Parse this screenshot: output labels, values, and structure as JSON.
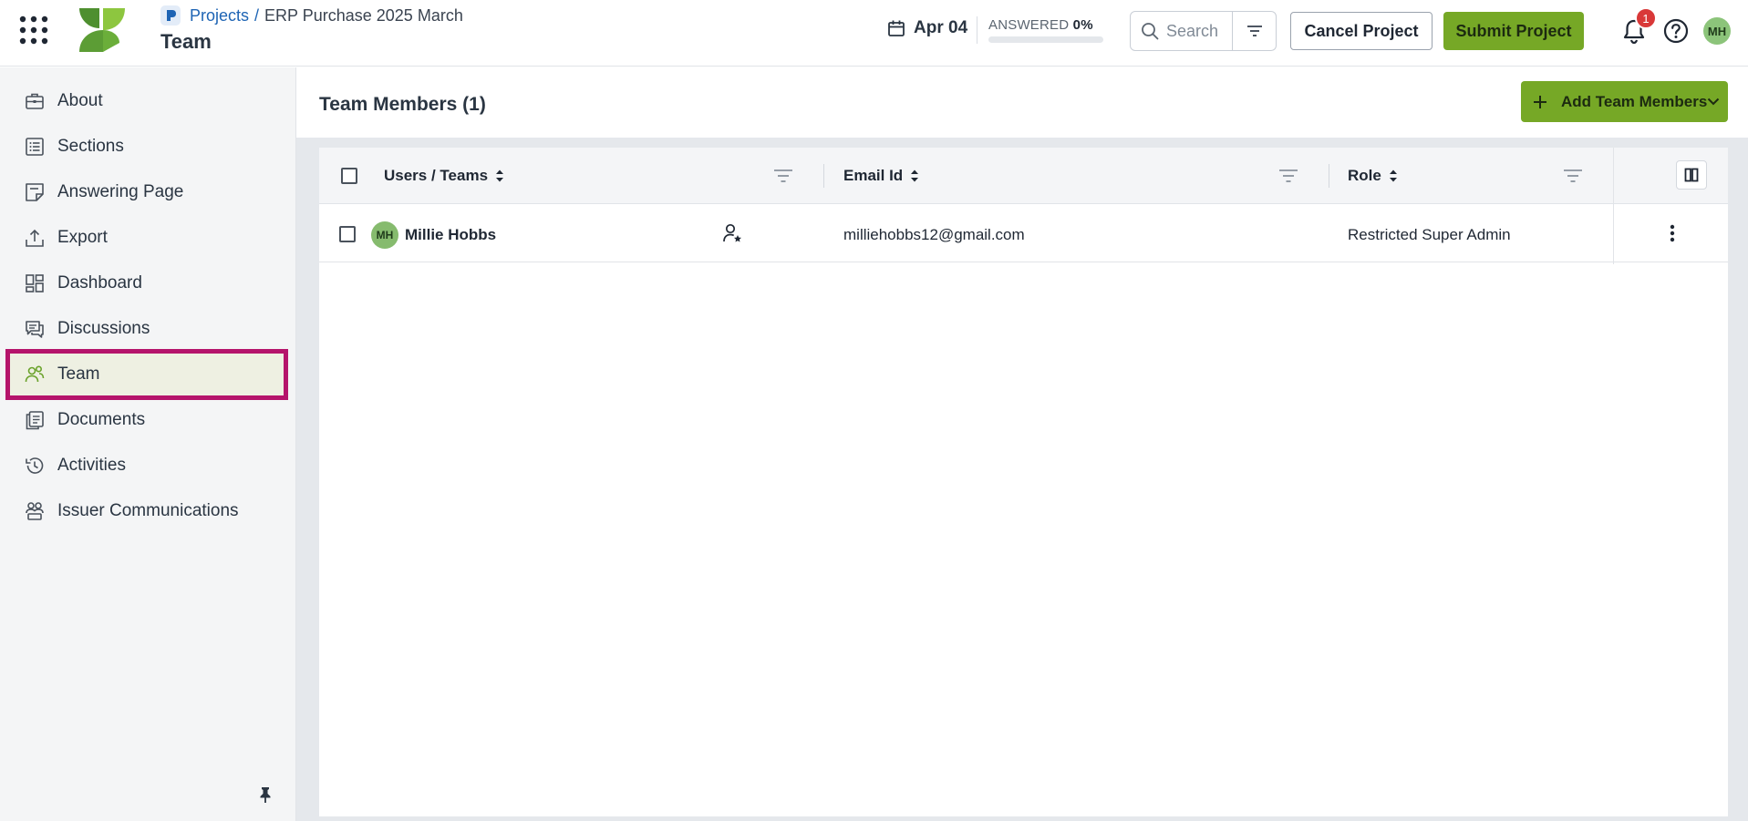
{
  "header": {
    "breadcrumb": {
      "projects_label": "Projects",
      "separator": "/",
      "project_name": "ERP Purchase 2025 March"
    },
    "page_title": "Team",
    "due_date": "Apr 04",
    "answered_label": "ANSWERED",
    "answered_value": "0%",
    "answered_progress": 0,
    "search_placeholder": "Search",
    "cancel_label": "Cancel Project",
    "submit_label": "Submit Project",
    "notification_count": "1",
    "user_initials": "MH",
    "icons": [
      "apps-grid-icon",
      "logo",
      "calendar-icon",
      "search-icon",
      "filter-icon",
      "bell-icon",
      "help-icon"
    ]
  },
  "sidebar": {
    "items": [
      {
        "label": "About",
        "icon": "briefcase-icon"
      },
      {
        "label": "Sections",
        "icon": "list-icon"
      },
      {
        "label": "Answering Page",
        "icon": "note-icon"
      },
      {
        "label": "Export",
        "icon": "upload-icon"
      },
      {
        "label": "Dashboard",
        "icon": "dashboard-icon"
      },
      {
        "label": "Discussions",
        "icon": "chat-icon"
      },
      {
        "label": "Team",
        "icon": "team-icon",
        "active": true
      },
      {
        "label": "Documents",
        "icon": "documents-icon"
      },
      {
        "label": "Activities",
        "icon": "history-icon"
      },
      {
        "label": "Issuer Communications",
        "icon": "communications-icon"
      }
    ]
  },
  "main": {
    "title": "Team Members (1)",
    "add_button_label": "Add Team Members",
    "table": {
      "columns": [
        "Users / Teams",
        "Email Id",
        "Role"
      ],
      "rows": [
        {
          "initials": "MH",
          "name": "Millie Hobbs",
          "email": "milliehobbs12@gmail.com",
          "role": "Restricted Super Admin"
        }
      ]
    }
  },
  "colors": {
    "accent": "#76a826",
    "active_highlight_border": "#b5146b",
    "link": "#1e64b4",
    "badge": "#d93838"
  }
}
